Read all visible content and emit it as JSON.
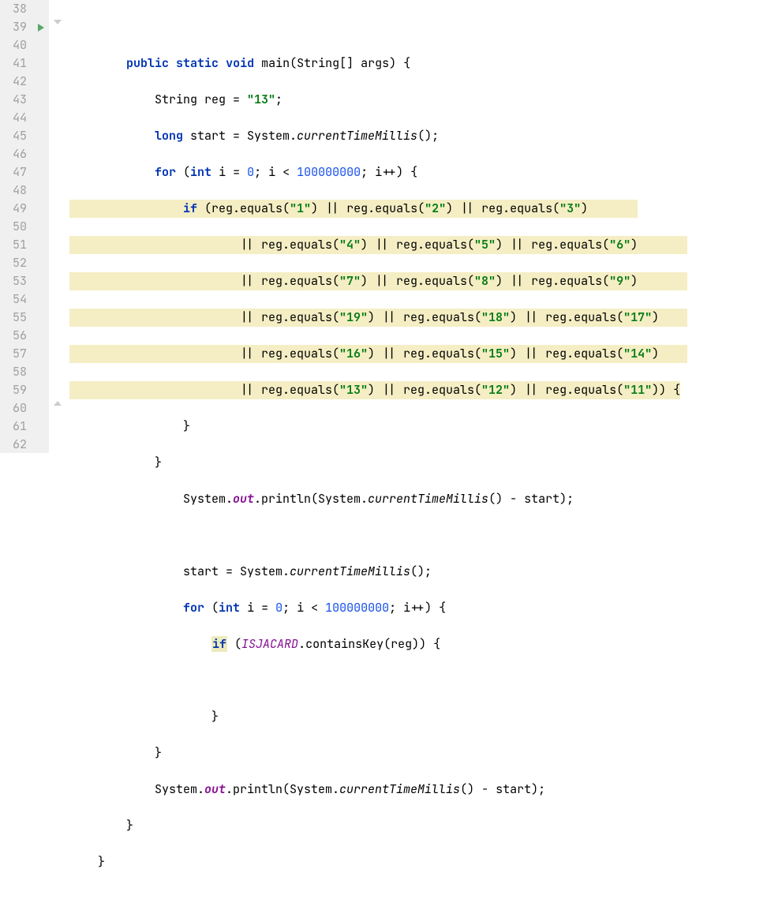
{
  "line_numbers": [
    "38",
    "39",
    "40",
    "41",
    "42",
    "43",
    "44",
    "45",
    "46",
    "47",
    "48",
    "49",
    "50",
    "51",
    "52",
    "53",
    "54",
    "55",
    "56",
    "57",
    "58",
    "59",
    "60",
    "61",
    "62"
  ],
  "code": {
    "l38": "",
    "l39_kw1": "public",
    "l39_kw2": "static",
    "l39_kw3": "void",
    "l39_main": " main(String[] args) {",
    "l40_pre": "            String reg = ",
    "l40_str": "\"13\"",
    "l40_post": ";",
    "l41_pre": "            ",
    "l41_kw": "long",
    "l41_mid": " start = System.",
    "l41_m": "currentTimeMillis",
    "l41_post": "();",
    "l42_pre": "            ",
    "l42_for": "for",
    "l42_a": " (",
    "l42_int": "int",
    "l42_b": " i = ",
    "l42_n0": "0",
    "l42_c": "; i < ",
    "l42_n1": "100000000",
    "l42_d": "; i++) {",
    "l43_pre": "                ",
    "l43_if": "if",
    "l43_a": " (reg.equals(",
    "l43_s1": "\"1\"",
    "l43_b": ") || reg.equals(",
    "l43_s2": "\"2\"",
    "l43_c": ") || reg.equals(",
    "l43_s3": "\"3\"",
    "l43_d": ")",
    "l44_pre": "                        || reg.equals(",
    "l44_s1": "\"4\"",
    "l44_b": ") || reg.equals(",
    "l44_s2": "\"5\"",
    "l44_c": ") || reg.equals(",
    "l44_s3": "\"6\"",
    "l44_d": ")",
    "l45_pre": "                        || reg.equals(",
    "l45_s1": "\"7\"",
    "l45_b": ") || reg.equals(",
    "l45_s2": "\"8\"",
    "l45_c": ") || reg.equals(",
    "l45_s3": "\"9\"",
    "l45_d": ")",
    "l46_pre": "                        || reg.equals(",
    "l46_s1": "\"19\"",
    "l46_b": ") || reg.equals(",
    "l46_s2": "\"18\"",
    "l46_c": ") || reg.equals(",
    "l46_s3": "\"17\"",
    "l46_d": ")",
    "l47_pre": "                        || reg.equals(",
    "l47_s1": "\"16\"",
    "l47_b": ") || reg.equals(",
    "l47_s2": "\"15\"",
    "l47_c": ") || reg.equals(",
    "l47_s3": "\"14\"",
    "l47_d": ")",
    "l48_pre": "                        || reg.equals(",
    "l48_s1": "\"13\"",
    "l48_b": ") || reg.equals(",
    "l48_s2": "\"12\"",
    "l48_c": ") || reg.equals(",
    "l48_s3": "\"11\"",
    "l48_d": ")) {",
    "l49": "                }",
    "l50": "            }",
    "l51_pre": "                System.",
    "l51_out": "out",
    "l51_a": ".println(System.",
    "l51_m": "currentTimeMillis",
    "l51_b": "() - start);",
    "l52": "",
    "l53_pre": "                start = System.",
    "l53_m": "currentTimeMillis",
    "l53_b": "();",
    "l54_pre": "                ",
    "l54_for": "for",
    "l54_a": " (",
    "l54_int": "int",
    "l54_b": " i = ",
    "l54_n0": "0",
    "l54_c": "; i < ",
    "l54_n1": "100000000",
    "l54_d": "; i++) {",
    "l55_pre": "                    ",
    "l55_if": "if",
    "l55_a": " (",
    "l55_v": "ISJACARD",
    "l55_b": ".containsKey(reg)) {",
    "l56": "",
    "l57": "                    }",
    "l58": "            }",
    "l59_pre": "            System.",
    "l59_out": "out",
    "l59_a": ".println(System.",
    "l59_m": "currentTimeMillis",
    "l59_b": "() - start);",
    "l60": "        }",
    "l61": "    }",
    "l62": ""
  }
}
